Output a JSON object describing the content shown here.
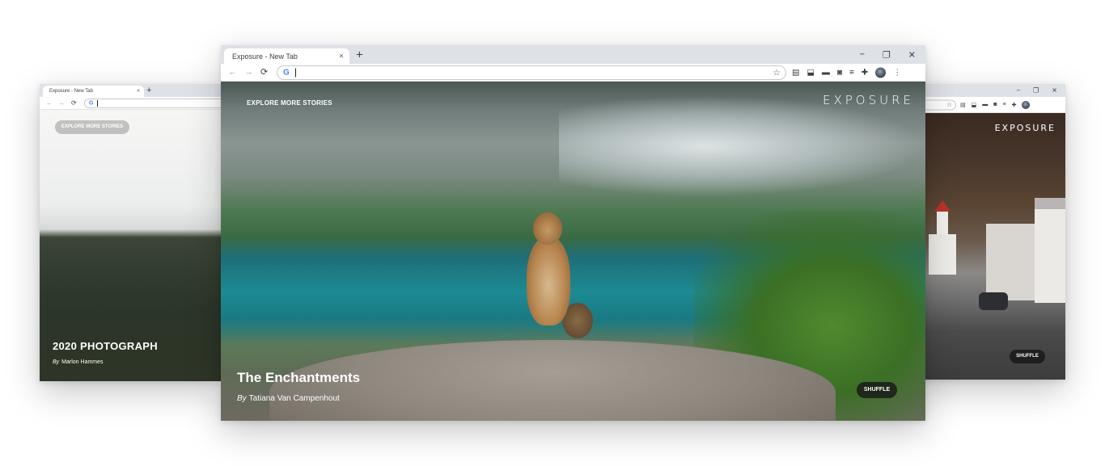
{
  "left_window": {
    "tab_title": "Exposure - New Tab",
    "new_tab": "+",
    "tab_close": "×",
    "nav": {
      "back": "←",
      "forward": "→",
      "reload": "⟳"
    },
    "omnibox_logo": "G",
    "explore_label": "EXPLORE MORE STORIES",
    "story_title": "2020 PHOTOGRAPH",
    "by": "By",
    "author": "Marlon Hammes"
  },
  "main_window": {
    "tab_title": "Exposure - New Tab",
    "new_tab": "+",
    "tab_close": "×",
    "window_controls": {
      "minimize": "−",
      "restore": "❐",
      "close": "✕"
    },
    "nav": {
      "back": "←",
      "forward": "→",
      "reload": "⟳"
    },
    "omnibox_logo": "G",
    "star": "☆",
    "explore_label": "EXPLORE MORE STORIES",
    "brand": "EXPOSURE",
    "story_title": "The Enchantments",
    "by": "By",
    "author": "Tatiana Van Campenhout",
    "shuffle_label": "SHUFFLE",
    "extensions": [
      "reading-list-icon",
      "download-icon",
      "tab-store-icon",
      "notion-icon",
      "list-icon",
      "puzzle-extensions-icon",
      "profile-avatar"
    ]
  },
  "right_window": {
    "window_controls": {
      "minimize": "−",
      "restore": "❐",
      "close": "✕"
    },
    "star": "☆",
    "brand": "EXPOSURE",
    "shuffle_label": "SHUFFLE"
  },
  "colors": {
    "tab_strip": "#dee1e6",
    "omnibox_border": "#c7c9cc",
    "shuffle_bg": "#141414",
    "church_roof": "#b6352b"
  }
}
